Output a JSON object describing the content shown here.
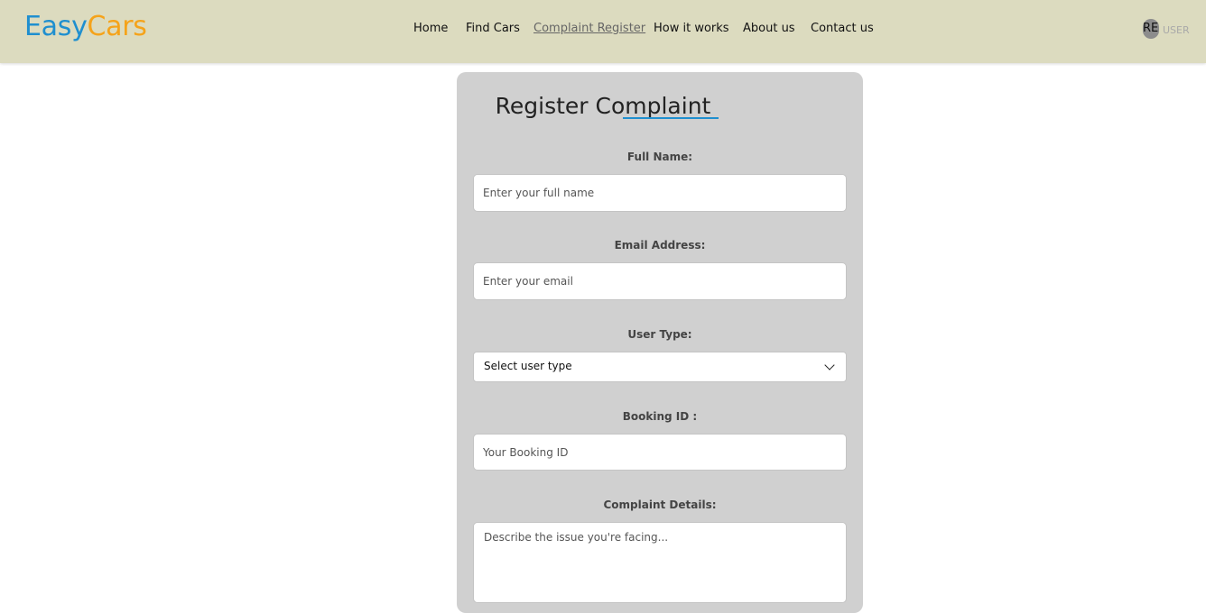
{
  "brand": {
    "part1": "Easy",
    "part2": "Cars",
    "color1": "#1f8fcf",
    "color2": "#f5a31a"
  },
  "nav": {
    "items": [
      {
        "label": "Home"
      },
      {
        "label": "Find Cars"
      },
      {
        "label": "Complaint Register",
        "active": true
      },
      {
        "label": "How it works"
      },
      {
        "label": "About us"
      },
      {
        "label": "Contact us"
      }
    ]
  },
  "user": {
    "initials": "RE",
    "label": "USER"
  },
  "form": {
    "title": "Register Complaint",
    "full_name": {
      "label": "Full Name:",
      "placeholder": "Enter your full name"
    },
    "email": {
      "label": "Email Address:",
      "placeholder": "Enter your email"
    },
    "user_type": {
      "label": "User Type:",
      "selected": "Select user type"
    },
    "booking_id": {
      "label": "Booking ID :",
      "placeholder": "Your Booking ID"
    },
    "details": {
      "label": "Complaint Details:",
      "placeholder": "Describe the issue you're facing..."
    }
  },
  "colors": {
    "header_bg": "#dcdbbf",
    "card_bg": "#d0d0d0",
    "accent": "#1f8fcf"
  },
  "icons": {
    "dropdown": "chevron-down-icon",
    "avatar": "avatar"
  }
}
